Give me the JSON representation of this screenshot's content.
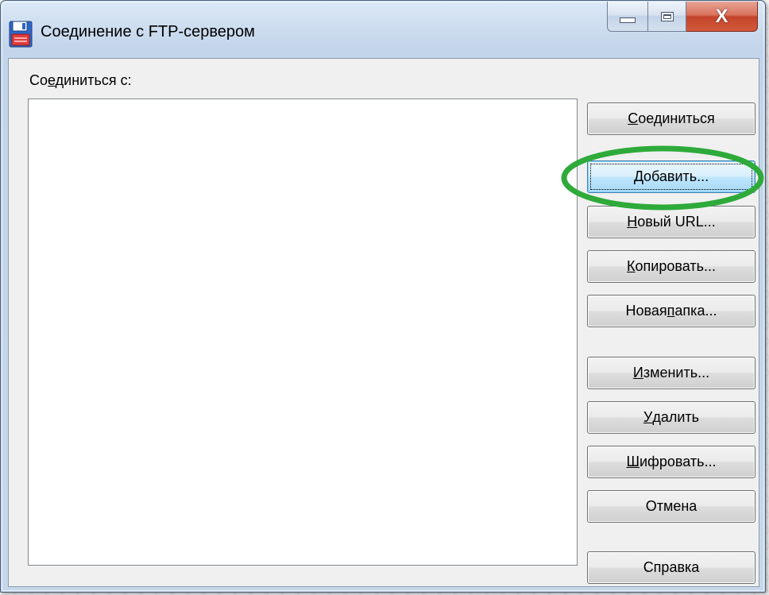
{
  "window": {
    "title": "Соединение с FTP-сервером",
    "icon": "floppy-disk-icon"
  },
  "caption_buttons": {
    "minimize_icon": "minimize-icon",
    "maximize_icon": "maximize-icon",
    "close_icon": "close-icon",
    "close_glyph": "X"
  },
  "dialog": {
    "connect_label": {
      "pre": "Со",
      "accel": "е",
      "post": "динить­ся с:"
    },
    "site_list_items": []
  },
  "buttons": [
    {
      "id": "connect",
      "pre": "",
      "accel": "С",
      "post": "оединиться"
    },
    {
      "id": "add",
      "pre": "",
      "accel": "Д",
      "post": "обавить..."
    },
    {
      "id": "new-url",
      "pre": "",
      "accel": "Н",
      "post": "овый URL..."
    },
    {
      "id": "copy",
      "pre": "",
      "accel": "К",
      "post": "опировать..."
    },
    {
      "id": "new-folder",
      "pre": "Новая ",
      "accel": "п",
      "post": "апка..."
    },
    {
      "id": "edit",
      "pre": "",
      "accel": "И",
      "post": "зменить..."
    },
    {
      "id": "delete",
      "pre": "",
      "accel": "У",
      "post": "далить"
    },
    {
      "id": "encrypt",
      "pre": "",
      "accel": "Ш",
      "post": "ифровать..."
    },
    {
      "id": "cancel",
      "pre": "Отмена",
      "accel": "",
      "post": ""
    },
    {
      "id": "help",
      "pre": "Справка",
      "accel": "",
      "post": ""
    }
  ],
  "annotation": {
    "color": "#2eaa3a",
    "target": "add"
  },
  "colors": {
    "focused_button": "#bee6fd",
    "frame": "#c3d5ea",
    "close_button": "#c4442b"
  }
}
